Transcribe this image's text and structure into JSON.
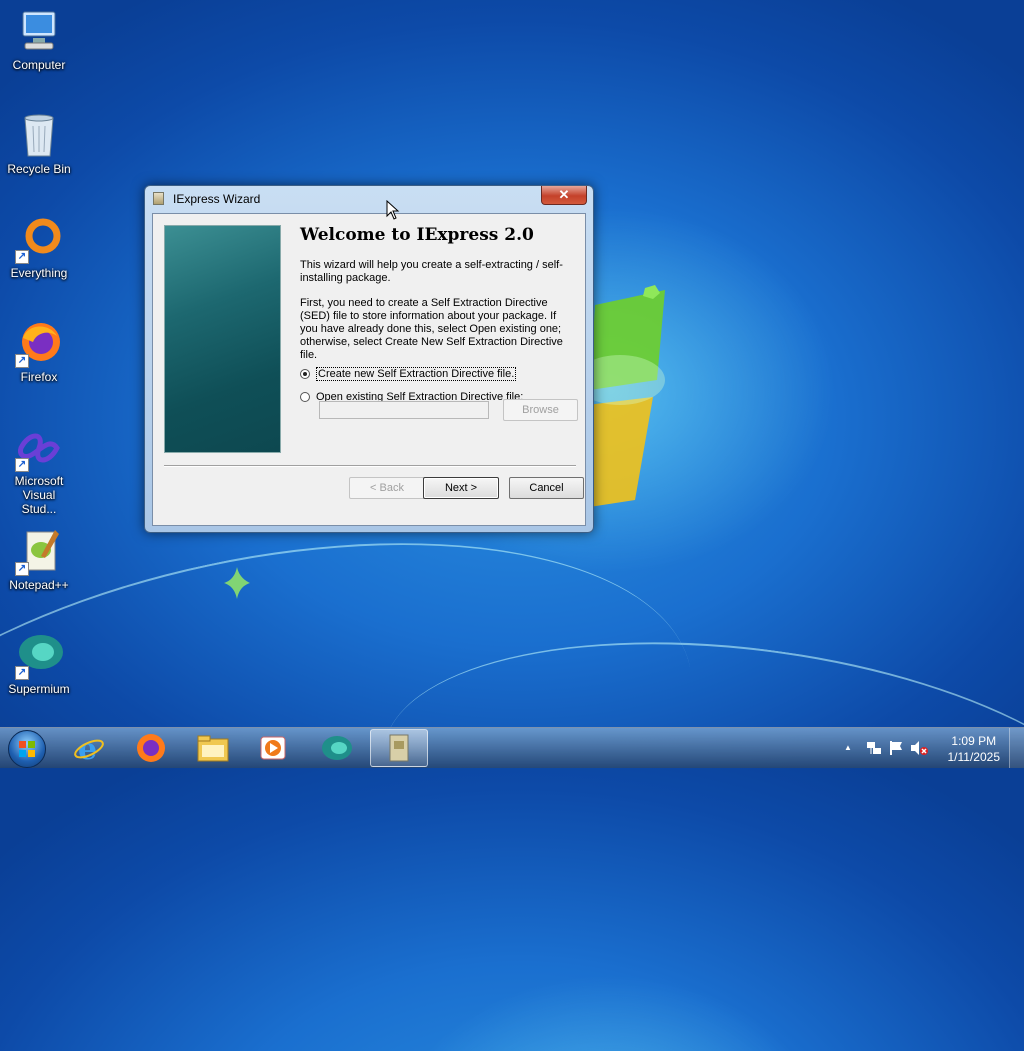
{
  "desktop": {
    "icons": [
      {
        "label": "Computer",
        "icon": "computer-icon"
      },
      {
        "label": "Recycle Bin",
        "icon": "recycle-bin-icon"
      },
      {
        "label": "Everything",
        "icon": "everything-icon"
      },
      {
        "label": "Firefox",
        "icon": "firefox-icon"
      },
      {
        "label": "Microsoft Visual Stud...",
        "icon": "visual-studio-icon"
      },
      {
        "label": "Notepad++",
        "icon": "notepadpp-icon"
      },
      {
        "label": "Supermium",
        "icon": "supermium-icon"
      }
    ]
  },
  "window": {
    "title": "IExpress Wizard",
    "close_glyph": "✕",
    "heading": "Welcome to IExpress 2.0",
    "intro": "This wizard will help you create a self-extracting / self-installing package.",
    "instructions": "First, you need to create a Self Extraction Directive (SED) file to store information about your package.  If you have already done this, select Open existing one; otherwise, select Create New Self Extraction Directive file.",
    "options": [
      {
        "label": "Create new Self Extraction Directive file.",
        "selected": true
      },
      {
        "label": "Open existing Self Extraction Directive file:",
        "selected": false
      }
    ],
    "path_value": "",
    "browse_label": "Browse",
    "back_label": "< Back",
    "next_label": "Next >",
    "cancel_label": "Cancel"
  },
  "taskbar": {
    "items": [
      "internet-explorer-icon",
      "firefox-icon",
      "file-explorer-icon",
      "media-player-icon",
      "supermium-icon",
      "iexpress-icon"
    ],
    "active_item": "iexpress-icon",
    "tray": {
      "chevron": "▲",
      "clock_time": "1:09 PM",
      "clock_date": "1/11/2025"
    }
  },
  "colors": {
    "desktop_blue": "#1a6fcf",
    "close_red": "#c4412a",
    "panel_teal": "#1d6870"
  }
}
